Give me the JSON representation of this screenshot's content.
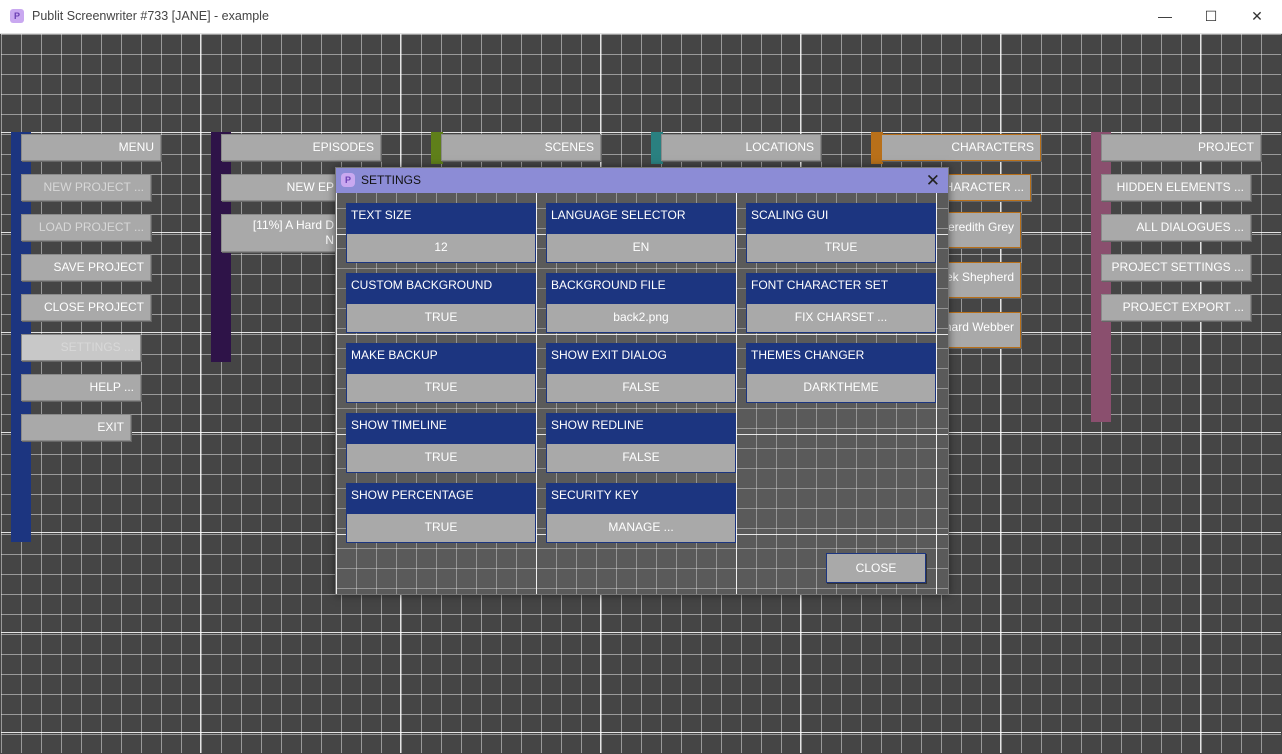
{
  "window": {
    "icon_letter": "P",
    "title": "Publit Screenwriter #733 [JANE] - example",
    "minimize": "—",
    "maximize": "☐",
    "close": "✕"
  },
  "menu": {
    "header": "MENU",
    "items": [
      "NEW PROJECT ...",
      "LOAD PROJECT ...",
      "SAVE PROJECT",
      "CLOSE PROJECT",
      "SETTINGS ...",
      "HELP ...",
      "EXIT"
    ]
  },
  "episodes": {
    "header": "EPISODES",
    "new_button": "NEW EP",
    "item_line1": "[11%] A Hard D",
    "item_line2": "N"
  },
  "scenes": {
    "header": "SCENES"
  },
  "locations": {
    "header": "LOCATIONS"
  },
  "characters": {
    "header": "CHARACTERS",
    "new_button": "CHARACTER ...",
    "items": [
      "Meredith Grey",
      "rek Shepherd",
      "hard Webber"
    ]
  },
  "project": {
    "header": "PROJECT",
    "items": [
      "HIDDEN ELEMENTS ...",
      "ALL DIALOGUES ...",
      "PROJECT SETTINGS ...",
      "PROJECT EXPORT ..."
    ]
  },
  "settings_dialog": {
    "icon_letter": "P",
    "title": "SETTINGS",
    "close_x": "✕",
    "settings": [
      {
        "label": "TEXT SIZE",
        "value": "12"
      },
      {
        "label": "LANGUAGE SELECTOR",
        "value": "EN"
      },
      {
        "label": "SCALING GUI",
        "value": "TRUE"
      },
      {
        "label": "CUSTOM BACKGROUND",
        "value": "TRUE"
      },
      {
        "label": "BACKGROUND FILE",
        "value": "back2.png"
      },
      {
        "label": "FONT CHARACTER SET",
        "value": "FIX CHARSET ..."
      },
      {
        "label": "MAKE BACKUP",
        "value": "TRUE"
      },
      {
        "label": "SHOW EXIT DIALOG",
        "value": "FALSE"
      },
      {
        "label": "THEMES CHANGER",
        "value": "DARKTHEME"
      },
      {
        "label": "SHOW TIMELINE",
        "value": "TRUE"
      },
      {
        "label": "SHOW REDLINE",
        "value": "FALSE"
      },
      {
        "label": "SHOW PERCENTAGE",
        "value": "TRUE"
      },
      {
        "label": "SECURITY KEY",
        "value": "MANAGE ..."
      }
    ],
    "close_button": "CLOSE"
  },
  "colors": {
    "menu_bar": "#1c3580",
    "episodes_bar": "#2e1348",
    "scenes_bar": "#5f7f1a",
    "locations_bar": "#2a8080",
    "characters_bar": "#b8701a",
    "project_bar": "#8a4f6e",
    "dialog_title": "#8c8cd6",
    "setting_header": "#1c3580"
  }
}
